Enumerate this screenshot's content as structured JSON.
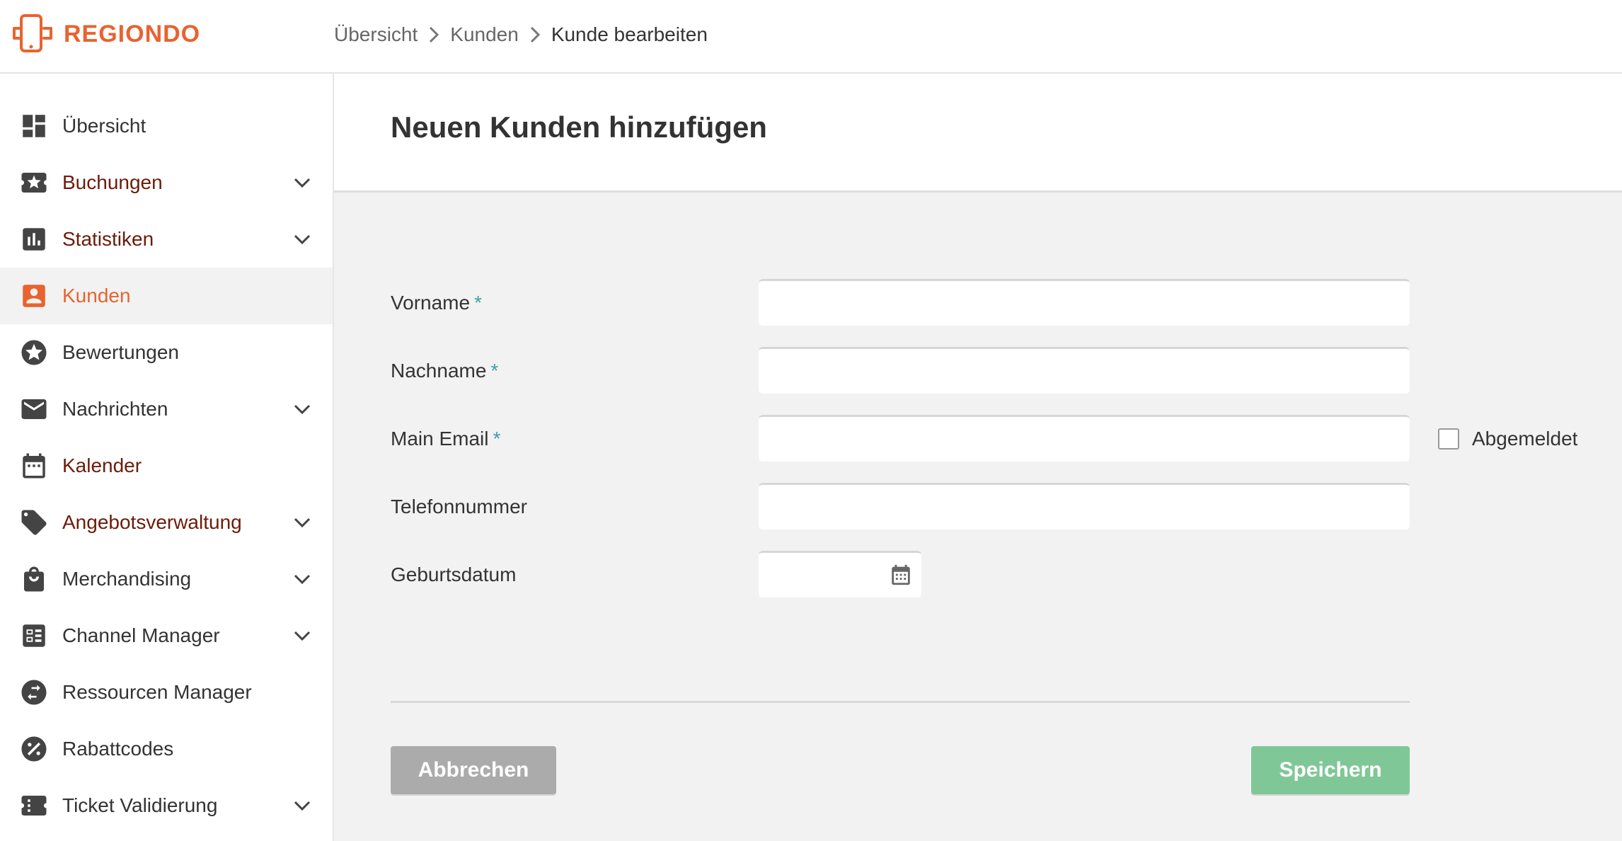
{
  "app": {
    "logo_text": "REGIONDO",
    "brand_color": "#e8632f"
  },
  "breadcrumb": [
    {
      "label": "Übersicht"
    },
    {
      "label": "Kunden"
    },
    {
      "label": "Kunde bearbeiten"
    }
  ],
  "sidebar": {
    "items": [
      {
        "label": "Übersicht",
        "icon": "dashboard-icon",
        "expandable": false
      },
      {
        "label": "Buchungen",
        "icon": "ticket-star-icon",
        "expandable": true
      },
      {
        "label": "Statistiken",
        "icon": "bar-chart-icon",
        "expandable": true
      },
      {
        "label": "Kunden",
        "icon": "customer-icon",
        "expandable": false,
        "active": true
      },
      {
        "label": "Bewertungen",
        "icon": "star-icon",
        "expandable": false
      },
      {
        "label": "Nachrichten",
        "icon": "mail-icon",
        "expandable": true
      },
      {
        "label": "Kalender",
        "icon": "calendar-icon",
        "expandable": false
      },
      {
        "label": "Angebotsverwaltung",
        "icon": "tag-icon",
        "expandable": true
      },
      {
        "label": "Merchandising",
        "icon": "shopping-bag-icon",
        "expandable": true
      },
      {
        "label": "Channel Manager",
        "icon": "channel-grid-icon",
        "expandable": true
      },
      {
        "label": "Ressourcen Manager",
        "icon": "swap-icon",
        "expandable": false
      },
      {
        "label": "Rabattcodes",
        "icon": "percent-icon",
        "expandable": false
      },
      {
        "label": "Ticket Validierung",
        "icon": "ticket-icon",
        "expandable": true
      }
    ]
  },
  "page": {
    "title": "Neuen Kunden hinzufügen"
  },
  "form": {
    "required_marker": "*",
    "first_name": {
      "label": "Vorname",
      "value": "",
      "required": true
    },
    "last_name": {
      "label": "Nachname",
      "value": "",
      "required": true
    },
    "email": {
      "label": "Main Email",
      "value": "",
      "required": true
    },
    "phone": {
      "label": "Telefonnummer",
      "value": "",
      "required": false
    },
    "birthdate": {
      "label": "Geburtsdatum",
      "value": "",
      "required": false
    },
    "unsubscribed": {
      "label": "Abgemeldet",
      "checked": false
    }
  },
  "actions": {
    "cancel_label": "Abbrechen",
    "save_label": "Speichern",
    "save_color": "#80c797",
    "cancel_color": "#ababab"
  }
}
